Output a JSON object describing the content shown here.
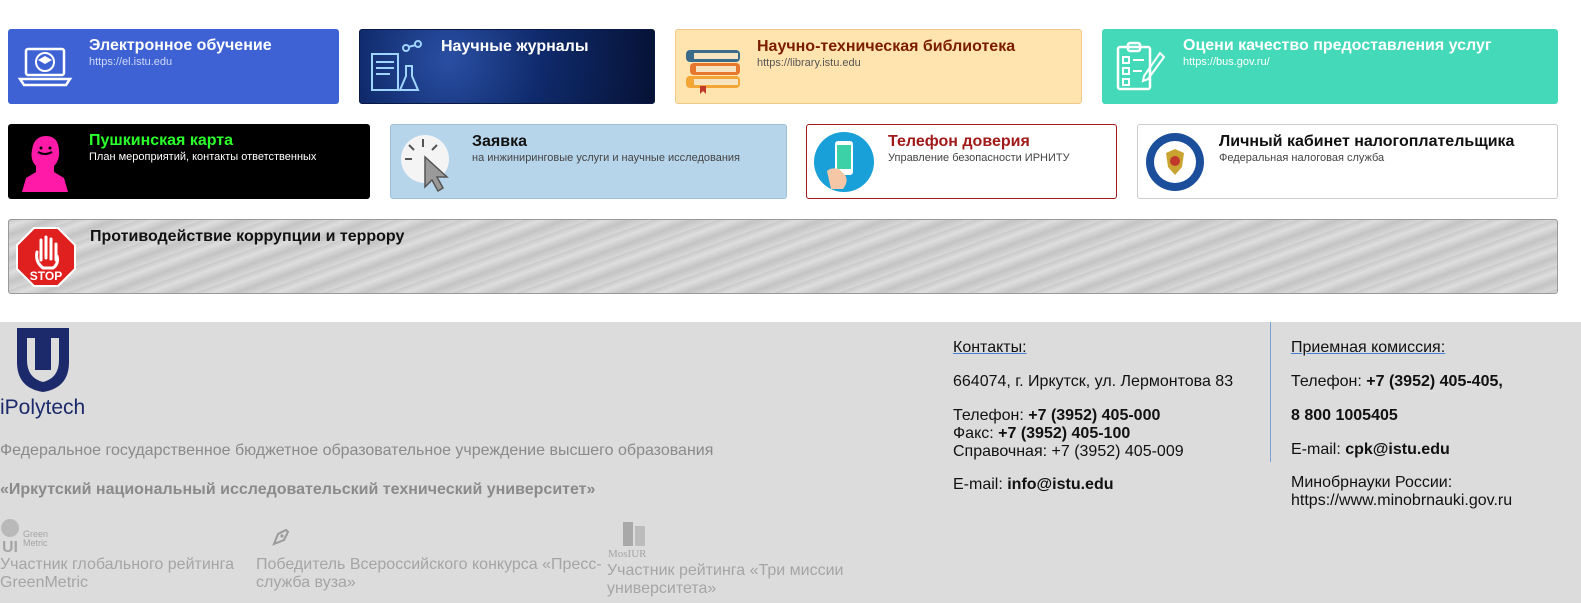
{
  "cards": {
    "el": {
      "title": "Электронное обучение",
      "sub": "https://el.istu.edu"
    },
    "journals": {
      "title": "Научные журналы"
    },
    "library": {
      "title": "Научно-техническая библиотека",
      "sub": "https://library.istu.edu"
    },
    "quality": {
      "title": "Оцени качество предоставления услуг",
      "sub": "https://bus.gov.ru/"
    },
    "pushkin": {
      "title": "Пушкинская карта",
      "sub": "План мероприятий, контакты ответственных"
    },
    "request": {
      "title": "Заявка",
      "sub": "на инжиниринговые услуги и научные исследования"
    },
    "trust": {
      "title": "Телефон доверия",
      "sub": "Управление безопасности ИРНИТУ"
    },
    "tax": {
      "title": "Личный кабинет налогоплательщика",
      "sub": "Федеральная налоговая служба"
    },
    "corruption": {
      "title": "Противодействие коррупции и террору"
    }
  },
  "footer": {
    "logo_text": "iPolytech",
    "org_line1": "Федеральное государственное бюджетное образовательное учреждение высшего образования",
    "org_line2": "«Иркутский национальный исследовательский технический университет»",
    "badges": [
      {
        "logo_text": "Green Metric",
        "text": "Участник глобального рейтинга GreenMetric"
      },
      {
        "text": "Победитель Всероссийского конкурса «Пресс-служба вуза»"
      },
      {
        "logo_text": "MosIUR",
        "text": "Участник рейтинга «Три миссии университета»"
      }
    ],
    "contacts": {
      "heading": "Контакты:",
      "address": "664074, г. Иркутск, ул. Лермонтова 83",
      "phone_label": "Телефон: ",
      "phone": "+7 (3952) 405-000",
      "fax_label": "Факс: ",
      "fax": "+7 (3952) 405-100",
      "info_line": "Справочная: +7 (3952) 405-009",
      "email_label": "E-mail: ",
      "email": "info@istu.edu"
    },
    "admission": {
      "heading": "Приемная комиссия:",
      "phone_label": "Телефон: ",
      "phone": "+7 (3952) 405-405,",
      "phone2": "8 800 1005405",
      "email_label": "E-mail: ",
      "email": "cpk@istu.edu",
      "ministry_label": "Минобрнауки России:",
      "ministry_url": "https://www.minobrnauki.gov.ru"
    }
  },
  "colors": {
    "footer_bg": "#dcdcdc",
    "link_underline": "#4a7fd4"
  }
}
